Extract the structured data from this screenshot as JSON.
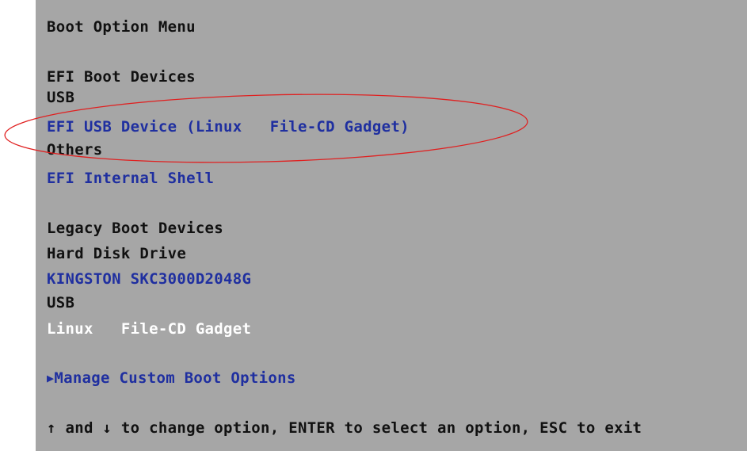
{
  "menu": {
    "title": "Boot Option Menu",
    "efi": {
      "heading": "EFI Boot Devices",
      "usb_label": "USB",
      "usb_device": "EFI USB Device (Linux   File-CD Gadget)",
      "others_label": "Others",
      "internal_shell": "EFI Internal Shell"
    },
    "legacy": {
      "heading": "Legacy Boot Devices",
      "hdd_label": "Hard Disk Drive",
      "hdd_device": "KINGSTON SKC3000D2048G",
      "usb_label": "USB",
      "usb_device": "Linux   File-CD Gadget"
    },
    "manage_arrow": "▶",
    "manage_label": "Manage Custom Boot Options",
    "help_text": "↑ and ↓ to change option, ENTER to select an option, ESC to exit"
  },
  "annotation": {
    "color": "#e02020"
  },
  "colors": {
    "background": "#a6a6a6",
    "text": "#111111",
    "selectable": "#1f2fa0",
    "highlighted": "#ffffff"
  }
}
